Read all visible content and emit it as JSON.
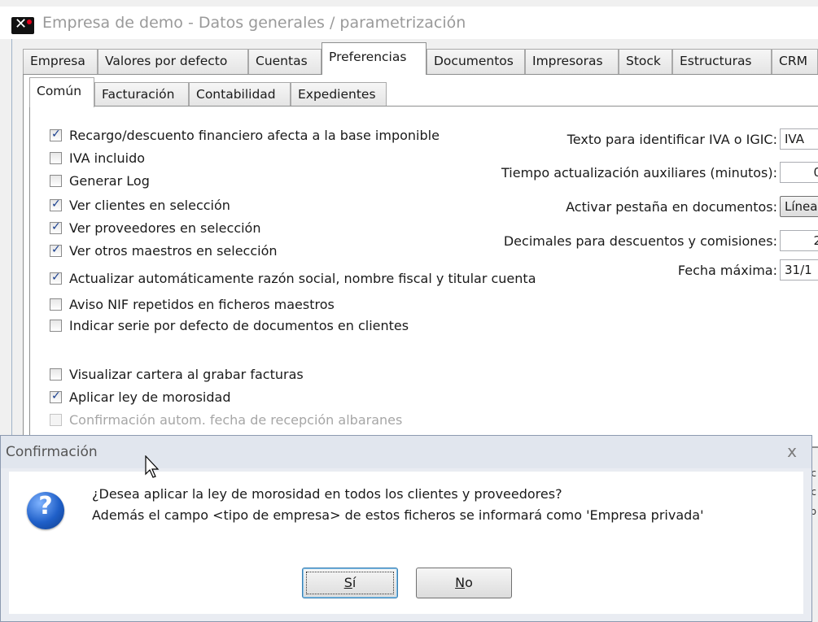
{
  "window": {
    "title": "Empresa de demo - Datos generales / parametrización"
  },
  "main_tabs": [
    "Empresa",
    "Valores por defecto",
    "Cuentas",
    "Preferencias",
    "Documentos",
    "Impresoras",
    "Stock",
    "Estructuras",
    "CRM"
  ],
  "main_tab_active": "Preferencias",
  "sub_tabs": [
    "Común",
    "Facturación",
    "Contabilidad",
    "Expedientes"
  ],
  "sub_tab_active": "Común",
  "checkboxes": [
    {
      "label": "Recargo/descuento financiero afecta a la base imponible",
      "checked": true
    },
    {
      "label": "IVA incluido",
      "checked": false
    },
    {
      "label": "Generar Log",
      "checked": false
    },
    {
      "label": "Ver clientes en selección",
      "checked": true
    },
    {
      "label": "Ver proveedores en selección",
      "checked": true
    },
    {
      "label": "Ver otros maestros en selección",
      "checked": true
    },
    {
      "label": "Actualizar automáticamente razón social, nombre fiscal y titular cuenta",
      "checked": true
    },
    {
      "label": "Aviso NIF repetidos en ficheros maestros",
      "checked": false
    },
    {
      "label": "Indicar serie por defecto de documentos en clientes",
      "checked": false
    },
    {
      "label": "Visualizar cartera al grabar facturas",
      "checked": false
    },
    {
      "label": "Aplicar ley de morosidad",
      "checked": true
    },
    {
      "label": "Confirmación autom. fecha de recepción albaranes",
      "checked": false,
      "disabled": true
    }
  ],
  "fields": {
    "iva_label": "Texto para identificar IVA o IGIC:",
    "iva_value": "IVA",
    "tiempo_label": "Tiempo actualización auxiliares (minutos):",
    "tiempo_value": "0",
    "pestana_label": "Activar pestaña en documentos:",
    "pestana_value": "Línea",
    "decimales_label": "Decimales para descuentos y comisiones:",
    "decimales_value": "2",
    "fecha_label": "Fecha máxima:",
    "fecha_value": "31/1"
  },
  "dialog": {
    "title": "Confirmación",
    "close": "x",
    "icon": "question-icon",
    "line1": "¿Desea aplicar la ley de morosidad en todos los clientes y proveedores?",
    "line2": "Además el campo <tipo de empresa> de estos ficheros se informará como 'Empresa privada'",
    "yes_accel": "S",
    "yes_rest": "í",
    "no_accel": "N",
    "no_rest": "o"
  },
  "colors": {
    "check": "#1a3f8e",
    "dialog_bg": "#e9ecf2",
    "icon_blue": "#1f5fc8"
  }
}
